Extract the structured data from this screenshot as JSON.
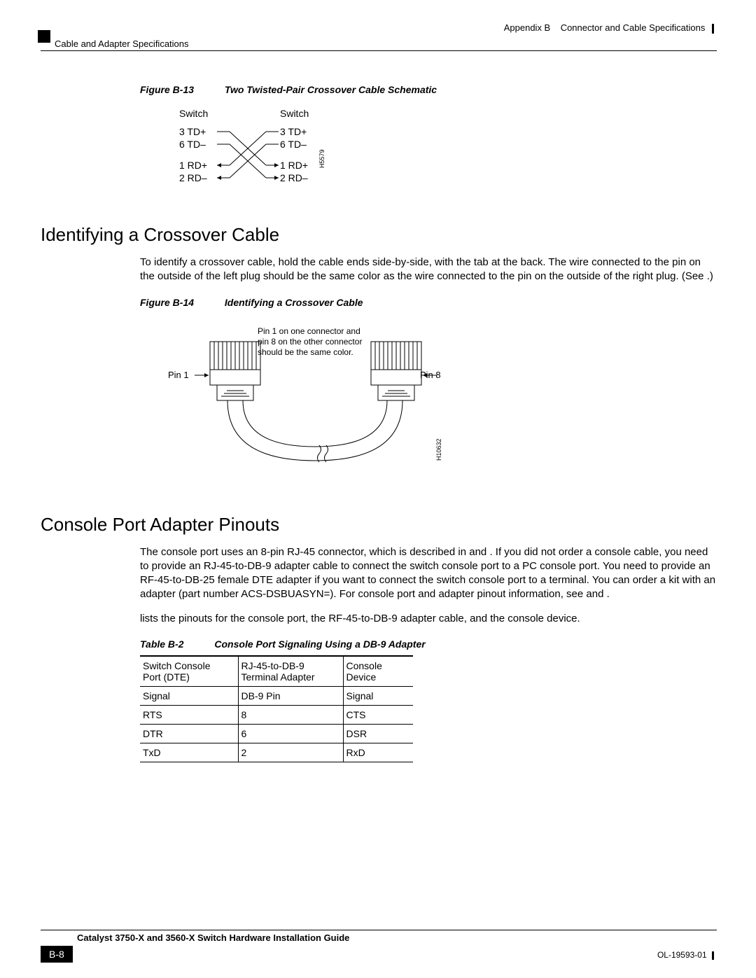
{
  "header": {
    "appendix": "Appendix B",
    "appendix_title": "Connector and Cable Specifications",
    "section_crumb": "Cable and Adapter Specifications"
  },
  "figB13": {
    "label": "Figure B-13",
    "title": "Two Twisted-Pair Crossover Cable Schematic",
    "left_header": "Switch",
    "right_header": "Switch",
    "left_pins": [
      "3 TD+",
      "6 TD–",
      "1 RD+",
      "2 RD–"
    ],
    "right_pins": [
      "3 TD+",
      "6 TD–",
      "1 RD+",
      "2 RD–"
    ],
    "ref": "H5579"
  },
  "sec1": {
    "heading": "Identifying a Crossover Cable",
    "para": "To identify a crossover cable, hold the cable ends side-by-side, with the tab at the back. The wire connected to the pin on the outside of the left plug should be the same color as the wire connected to the pin on the outside of the right plug. (See                    .)"
  },
  "figB14": {
    "label": "Figure B-14",
    "title": "Identifying a Crossover Cable",
    "pin1": "Pin 1",
    "pin8": "Pin 8",
    "note_l1": "Pin 1 on one connector and",
    "note_l2": "pin 8 on the other connector",
    "note_l3": "should be the same color.",
    "ref": "H10632"
  },
  "sec2": {
    "heading": "Console Port Adapter Pinouts",
    "para1": "The console port uses an 8-pin RJ-45 connector, which is described in                 and             . If you did not order a console cable, you need to provide an RJ-45-to-DB-9 adapter cable to connect the switch console port to a PC console port. You need to provide an RF-45-to-DB-25 female DTE adapter if you want to connect the switch console port to a terminal. You can order a kit with an adapter (part number ACS-DSBUASYN=). For console port and adapter pinout information, see                 and             .",
    "para2": "lists the pinouts for the console port, the RF-45-to-DB-9 adapter cable, and the console device."
  },
  "tableB2": {
    "label": "Table B-2",
    "title": "Console Port Signaling Using a DB-9 Adapter",
    "h1a": "Switch Console",
    "h1b": "Port (DTE)",
    "h2a": "RJ-45-to-DB-9",
    "h2b": "Terminal Adapter",
    "h3a": "Console",
    "h3b": "Device",
    "sub1": "Signal",
    "sub2": "DB-9 Pin",
    "sub3": "Signal",
    "rows": [
      {
        "c1": "RTS",
        "c2": "8",
        "c3": "CTS"
      },
      {
        "c1": "DTR",
        "c2": "6",
        "c3": "DSR"
      },
      {
        "c1": "TxD",
        "c2": "2",
        "c3": "RxD"
      }
    ]
  },
  "footer": {
    "guide": "Catalyst 3750-X and 3560-X Switch Hardware Installation Guide",
    "page": "B-8",
    "doc": "OL-19593-01"
  }
}
